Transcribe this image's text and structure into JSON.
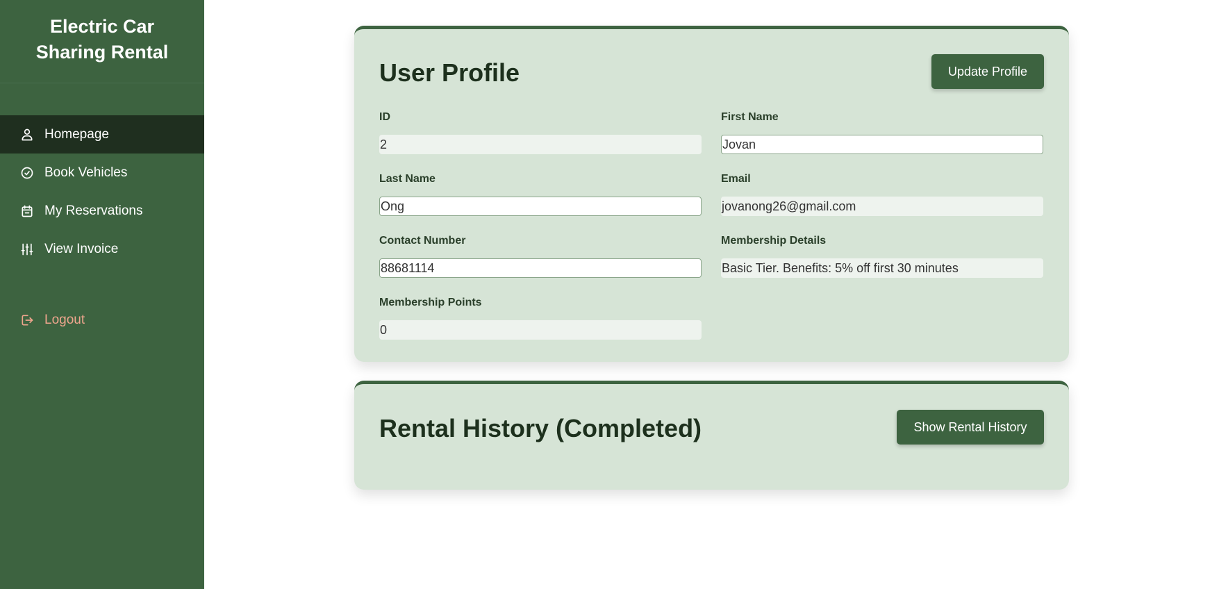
{
  "sidebar": {
    "brand_line1": "Electric Car",
    "brand_line2": "Sharing Rental",
    "items": [
      {
        "label": "Homepage",
        "icon": "user-icon",
        "active": true
      },
      {
        "label": "Book Vehicles",
        "icon": "check-circle-icon",
        "active": false
      },
      {
        "label": "My Reservations",
        "icon": "calendar-icon",
        "active": false
      },
      {
        "label": "View Invoice",
        "icon": "sliders-icon",
        "active": false
      }
    ],
    "logout_label": "Logout"
  },
  "profile": {
    "title": "User Profile",
    "update_button": "Update Profile",
    "fields": {
      "id": {
        "label": "ID",
        "value": "2"
      },
      "first_name": {
        "label": "First Name",
        "value": "Jovan"
      },
      "last_name": {
        "label": "Last Name",
        "value": "Ong"
      },
      "email": {
        "label": "Email",
        "value": "jovanong26@gmail.com"
      },
      "contact": {
        "label": "Contact Number",
        "value": "88681114"
      },
      "membership_details": {
        "label": "Membership Details",
        "value": "Basic Tier. Benefits: 5% off first 30 minutes"
      },
      "membership_points": {
        "label": "Membership Points",
        "value": "0"
      }
    }
  },
  "history": {
    "title": "Rental History (Completed)",
    "show_button": "Show Rental History"
  },
  "colors": {
    "sidebar_bg": "#3d6340",
    "sidebar_active": "#1f2f1f",
    "card_bg": "#d6e4d6",
    "accent": "#3d6340",
    "logout": "#f0a68e"
  }
}
